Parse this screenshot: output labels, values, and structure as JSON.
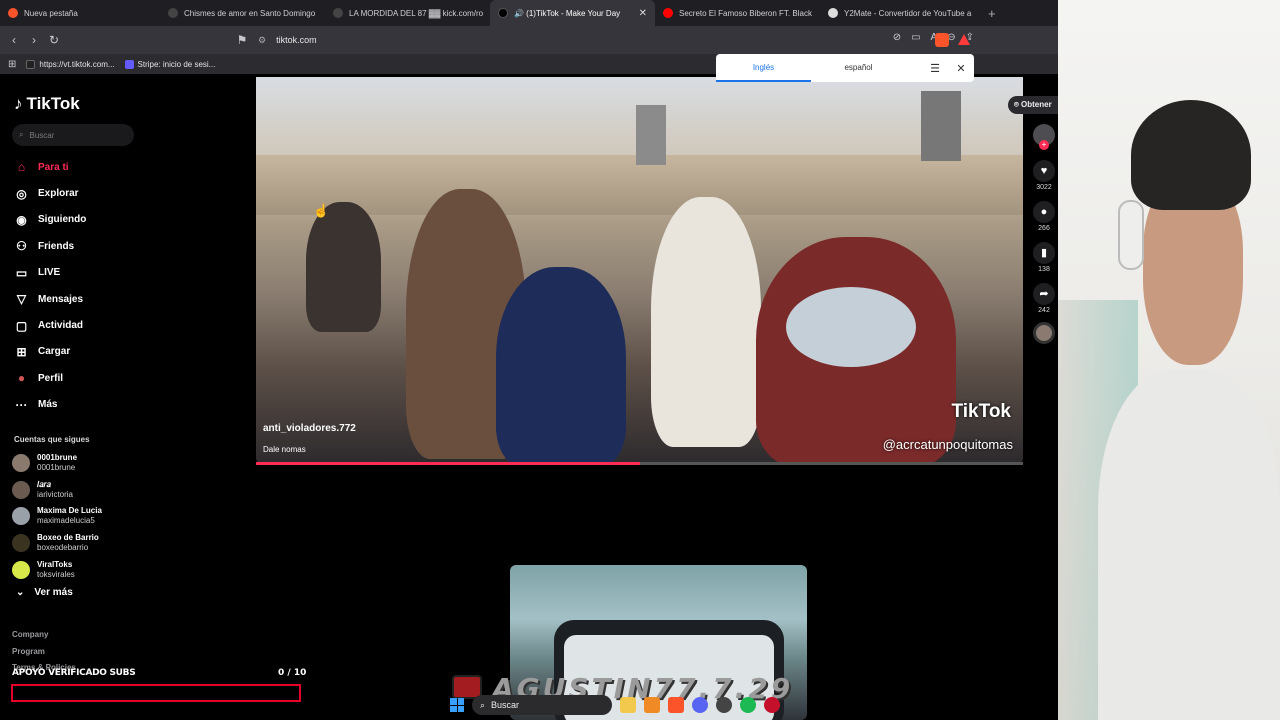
{
  "browser": {
    "tabs": [
      {
        "title": "Nueva pestaña",
        "color": "#fb542b",
        "active": false
      },
      {
        "title": "Chismes de amor en Santo Domingo",
        "color": "#444",
        "active": false
      },
      {
        "title": "LA MORDIDA DEL 87 ▓▓ kick.com/ro",
        "color": "#444",
        "active": false
      },
      {
        "title": "🔊 (1)TikTok - Make Your Day",
        "color": "#000",
        "active": true
      },
      {
        "title": "Secreto El Famoso Biberon FT. Black",
        "color": "#ff0000",
        "active": false
      },
      {
        "title": "Y2Mate - Convertidor de YouTube a",
        "color": "#ddd",
        "active": false
      }
    ],
    "url": "tiktok.com",
    "bookmarks": [
      {
        "label": "https://vt.tiktok.com...",
        "color": "#222"
      },
      {
        "label": "Stripe: inicio de sesi...",
        "color": "#635bff"
      }
    ]
  },
  "translate": {
    "lang1": "Inglés",
    "lang2": "español"
  },
  "tiktok": {
    "logo": "TikTok",
    "search_placeholder": "Buscar",
    "nav": [
      {
        "label": "Para ti",
        "icon": "⌂",
        "active": true
      },
      {
        "label": "Explorar",
        "icon": "◎",
        "active": false
      },
      {
        "label": "Siguiendo",
        "icon": "◉",
        "active": false
      },
      {
        "label": "Friends",
        "icon": "⚇",
        "active": false
      },
      {
        "label": "LIVE",
        "icon": "▭",
        "active": false
      },
      {
        "label": "Mensajes",
        "icon": "▽",
        "active": false
      },
      {
        "label": "Actividad",
        "icon": "▢",
        "active": false
      },
      {
        "label": "Cargar",
        "icon": "⊞",
        "active": false
      },
      {
        "label": "Perfil",
        "icon": "●",
        "active": false
      },
      {
        "label": "Más",
        "icon": "···",
        "active": false
      }
    ],
    "following_title": "Cuentas que sigues",
    "following": [
      {
        "name": "0001brune",
        "handle": "0001brune",
        "color": "#8a7a6e"
      },
      {
        "name": "𝐼𝑎𝑟𝑎",
        "handle": "iarivictoria",
        "color": "#6b5a50"
      },
      {
        "name": "Maxima De Lucia",
        "handle": "maximadelucia5",
        "color": "#9aa0a8"
      },
      {
        "name": "Boxeo de Barrio",
        "handle": "boxeodebarrio",
        "color": "#3a3320"
      },
      {
        "name": "ViralToks",
        "handle": "toksvirales",
        "color": "#d7e84a"
      }
    ],
    "ver_mas": "Ver más",
    "footer": [
      "Company",
      "Program",
      "Terms & Policies"
    ],
    "video": {
      "username": "anti_violadores.772",
      "caption": "Dale nomas",
      "watermark": "TikTok",
      "watermark_handle": "@acrcatunpoquitomas",
      "progress": 0.5
    },
    "obtener": "⌾ Obtener",
    "actions": {
      "likes": "3022",
      "comments": "266",
      "saves": "138",
      "shares": "242"
    }
  },
  "stream_overlay": {
    "sub_label": "APOYO VERIFICADO SUBS",
    "sub_count": "0 / 10",
    "streamer": "AGUSTIN77.7.29"
  },
  "taskbar": {
    "search": "Buscar"
  }
}
